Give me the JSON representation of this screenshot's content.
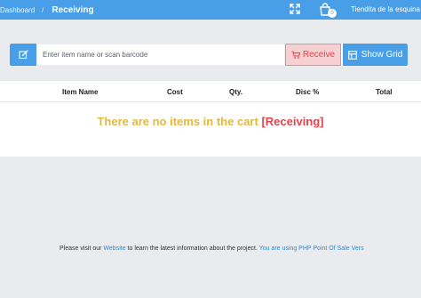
{
  "header": {
    "breadcrumb": {
      "home": "Dashboard",
      "separator": "/",
      "current": "Receiving"
    },
    "store_name": "Tiendita de la esquina",
    "cart_count": "0",
    "icons": [
      "fullscreen-icon",
      "cart-icon"
    ],
    "bg_color": "#489ee7"
  },
  "toolbar": {
    "edit_icon": "edit-icon",
    "search_placeholder": "Enter item name or scan barcode",
    "search_value": "",
    "receive_label": "Receive",
    "receive_icon": "cart-icon",
    "grid_label": "Show Grid",
    "grid_icon": "grid-icon"
  },
  "cart": {
    "columns": [
      "Item Name",
      "Cost",
      "Qty.",
      "Disc %",
      "Total"
    ],
    "empty_message": "There are no items in the cart",
    "empty_mode": "[Receiving]"
  },
  "footer": {
    "prefix": "Please visit our ",
    "link_text": "Website",
    "middle": " to learn the latest information about the project. ",
    "version_text": "You are using PHP Point Of Sale Vers"
  },
  "colors": {
    "primary": "#489ee7",
    "danger": "#e0444c",
    "danger_bg": "#f7d1d2",
    "warning": "#e2b93b",
    "page_bg": "#e9ebef"
  }
}
